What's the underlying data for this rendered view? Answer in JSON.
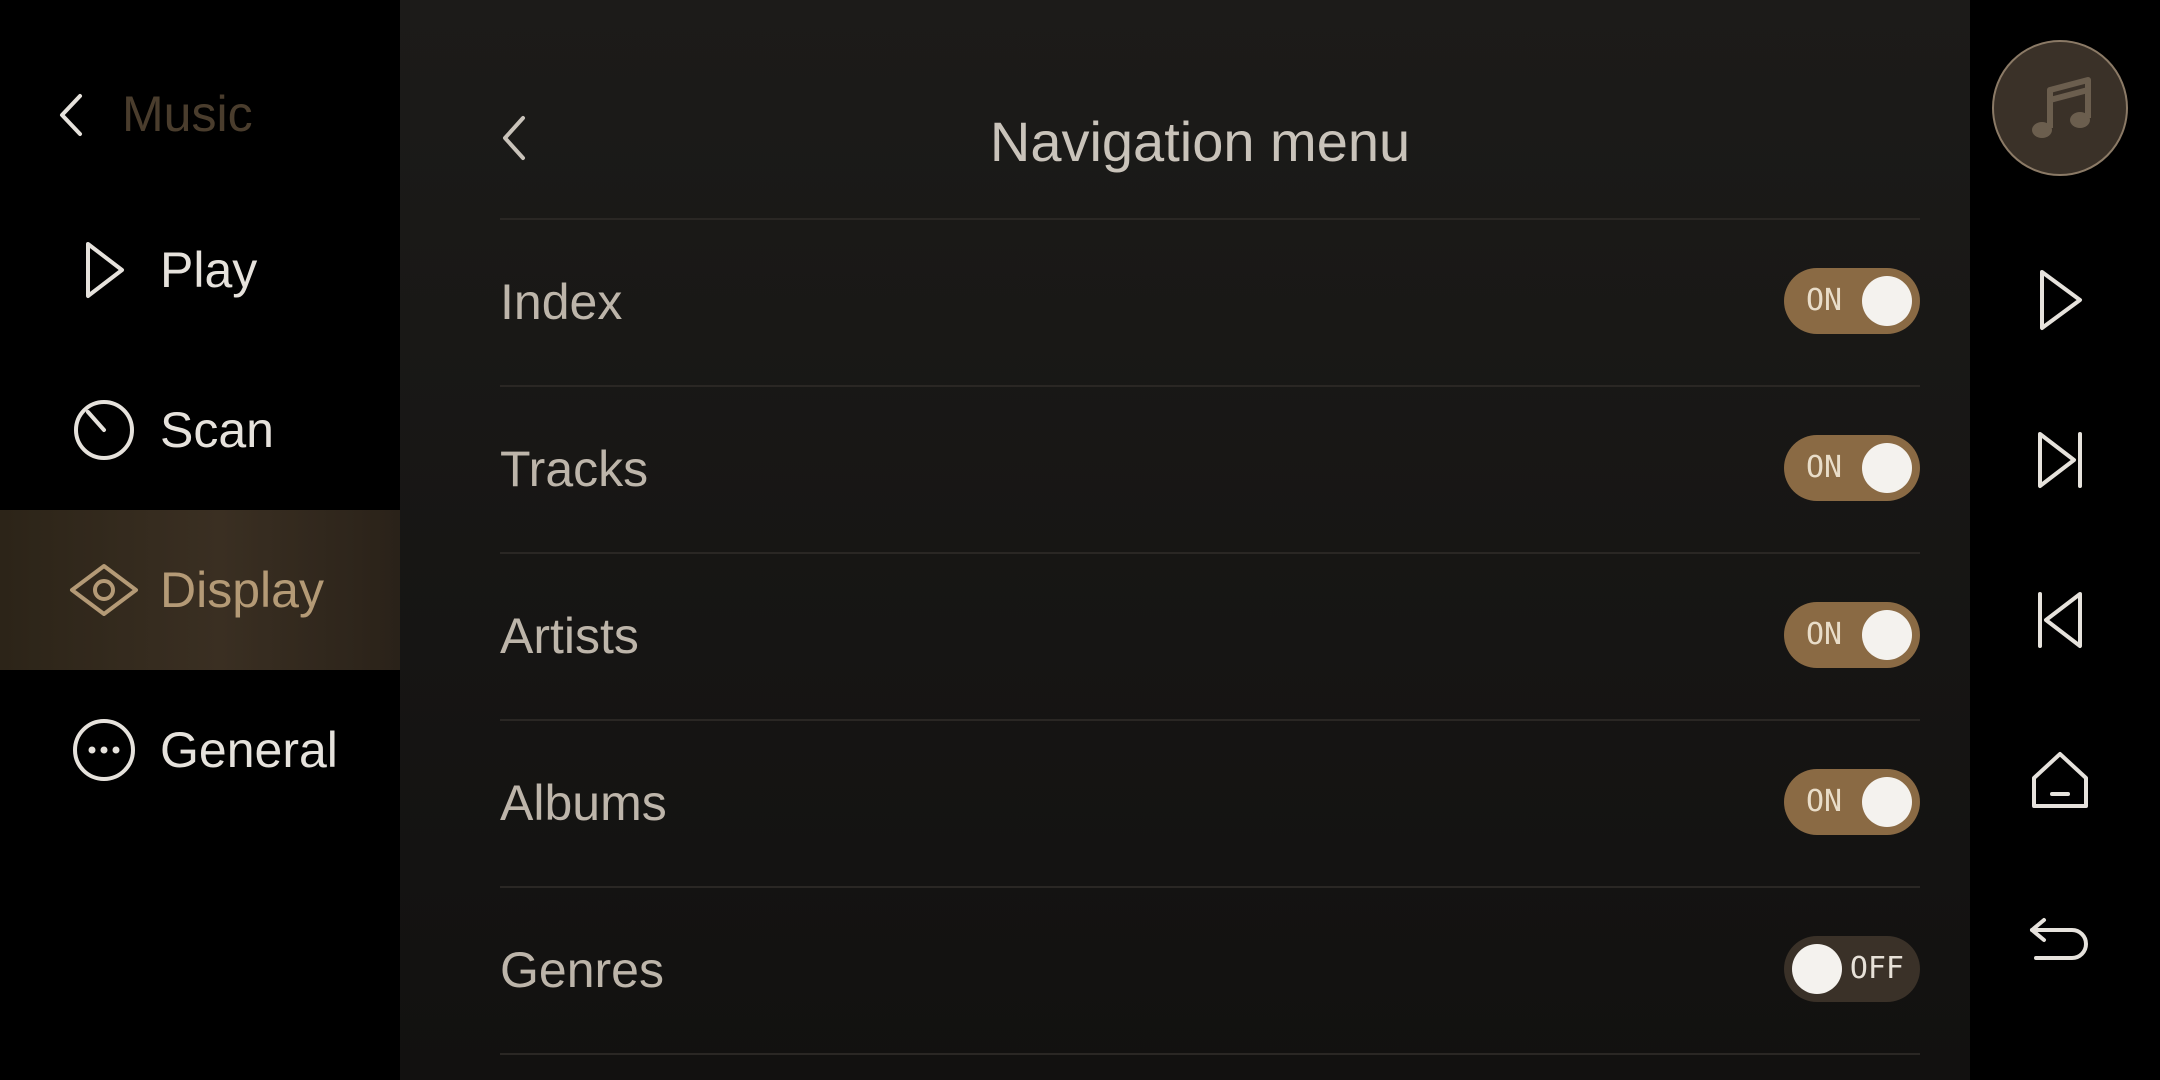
{
  "sidebar": {
    "back_icon": "chevron-left-icon",
    "title": "Music",
    "items": [
      {
        "label": "Play",
        "icon": "play-outline-icon",
        "active": false
      },
      {
        "label": "Scan",
        "icon": "scan-dial-icon",
        "active": false
      },
      {
        "label": "Display",
        "icon": "eye-icon",
        "active": true
      },
      {
        "label": "General",
        "icon": "more-horizontal-circle-icon",
        "active": false
      }
    ]
  },
  "main": {
    "back_icon": "chevron-left-icon",
    "title": "Navigation menu",
    "rows": [
      {
        "label": "Index",
        "toggle": "ON"
      },
      {
        "label": "Tracks",
        "toggle": "ON"
      },
      {
        "label": "Artists",
        "toggle": "ON"
      },
      {
        "label": "Albums",
        "toggle": "ON"
      },
      {
        "label": "Genres",
        "toggle": "OFF"
      }
    ]
  },
  "rail": {
    "buttons": [
      "music-note-icon",
      "play-icon",
      "skip-next-icon",
      "skip-previous-icon",
      "home-icon",
      "back-return-icon"
    ]
  },
  "colors": {
    "accent": "#8a6a44",
    "accent_text": "#b49a76",
    "background": "#000000",
    "panel": "#1a1917"
  }
}
